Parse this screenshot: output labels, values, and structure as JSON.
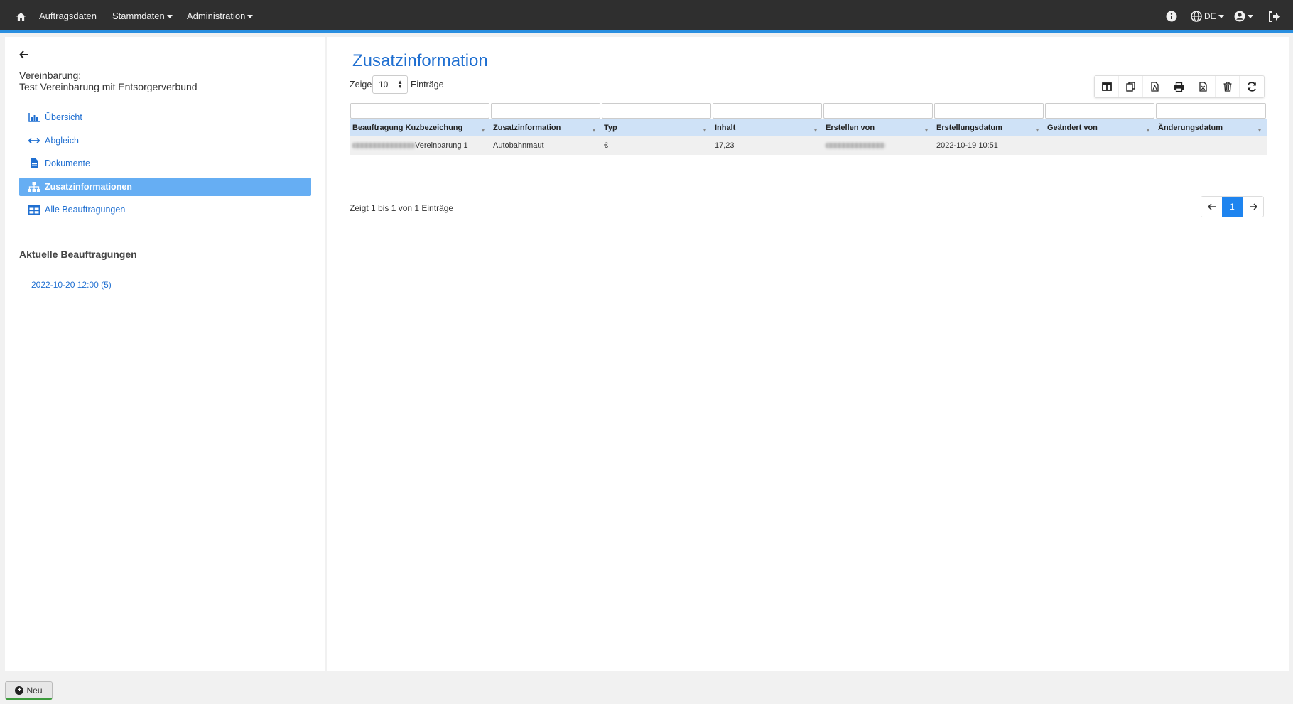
{
  "nav": {
    "home_icon": "home-icon",
    "items": [
      "Auftragsdaten",
      "Stammdaten",
      "Administration"
    ],
    "language": "DE"
  },
  "sidebar": {
    "agreement_label": "Vereinbarung:",
    "agreement_name": "Test Vereinbarung mit Entsorgerverbund",
    "items": [
      {
        "label": "Übersicht",
        "icon": "chart-icon"
      },
      {
        "label": "Abgleich",
        "icon": "arrows-horizontal-icon"
      },
      {
        "label": "Dokumente",
        "icon": "document-icon"
      },
      {
        "label": "Zusatzinformationen",
        "icon": "sitemap-icon",
        "active": true
      },
      {
        "label": "Alle Beauftragungen",
        "icon": "table-icon"
      }
    ],
    "current_title": "Aktuelle Beauftragungen",
    "current_link": "2022-10-20 12:00 (5)"
  },
  "main": {
    "title": "Zusatzinformation",
    "show_label": "Zeige",
    "page_size": "10",
    "entries_label": "Einträge",
    "toolbar": [
      "columns-icon",
      "copy-icon",
      "pdf-icon",
      "print-icon",
      "excel-icon",
      "trash-icon",
      "refresh-icon"
    ],
    "table": {
      "headers": [
        "Beauftragung Kuzbezeichung",
        "Zusatzinformation",
        "Typ",
        "Inhalt",
        "Erstellen von",
        "Erstellungsdatum",
        "Geändert von",
        "Änderungsdatum"
      ],
      "rows": [
        [
          "Vereinbarung 1",
          "Autobahnmaut",
          "€",
          "17,23",
          "",
          "2022-10-19 10:51",
          "",
          ""
        ]
      ]
    },
    "info": "Zeigt 1 bis 1 von 1 Einträge",
    "pager": {
      "current": "1"
    }
  },
  "footer": {
    "new_label": "Neu"
  },
  "colors": {
    "accent": "#1f6fd1",
    "active_bg": "#66aef3",
    "topbar": "#2f2f2f",
    "header_row": "#cfe2f7"
  }
}
